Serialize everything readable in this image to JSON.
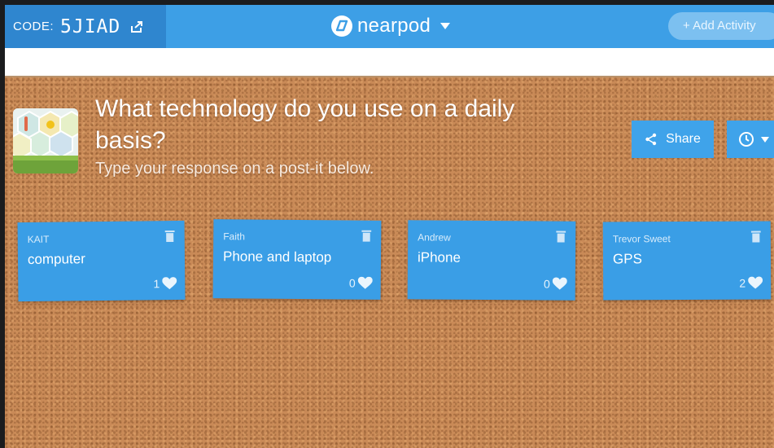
{
  "header": {
    "code_label": "CODE:",
    "code_value": "5JIAD",
    "brand_name": "nearpod",
    "add_activity_label": "+ Add Activity"
  },
  "activity": {
    "question": "What technology do you use on a daily basis?",
    "instruction": "Type your response on a post-it below.",
    "share_label": "Share"
  },
  "posts": [
    {
      "author": "KAIT",
      "response": "computer",
      "likes": "1"
    },
    {
      "author": "Faith",
      "response": "Phone and laptop",
      "likes": "0"
    },
    {
      "author": "Andrew",
      "response": "iPhone",
      "likes": "0"
    },
    {
      "author": "Trevor Sweet",
      "response": "GPS",
      "likes": "2"
    }
  ],
  "icons": {
    "code_share": "external-share-icon",
    "logo": "nearpod-logo-icon",
    "brand_menu": "chevron-down-icon",
    "share": "share-icon",
    "timer": "clock-icon",
    "timer_menu": "chevron-down-icon",
    "delete": "trash-icon",
    "like": "heart-icon"
  },
  "colors": {
    "topbar": "#3d9fe6",
    "code_box": "#2f86cf",
    "postit": "#3a9ee6",
    "cork": "#c98a57"
  }
}
